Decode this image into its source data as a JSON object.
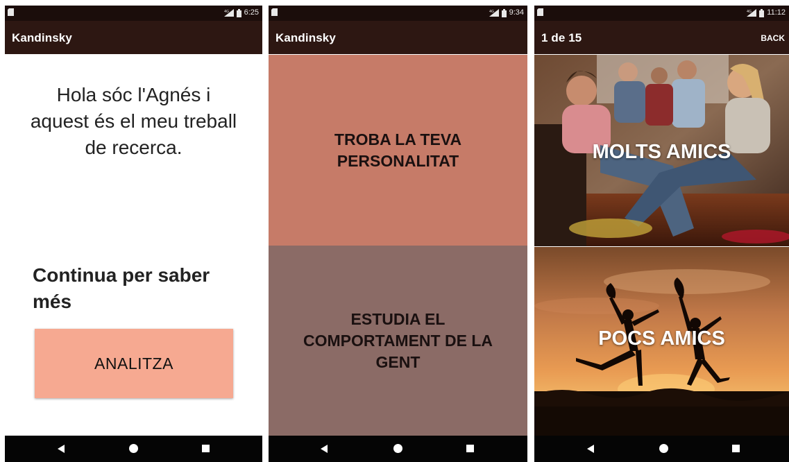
{
  "screens": [
    {
      "status_time": "6:25",
      "toolbar_title": "Kandinsky",
      "greeting": "Hola sóc l'Agnés i aquest és el meu treball de recerca.",
      "continue_text": "Continua per saber més",
      "analyze_button": "ANALITZA"
    },
    {
      "status_time": "9:34",
      "toolbar_title": "Kandinsky",
      "options": [
        {
          "label": "TROBA LA TEVA PERSONALITAT",
          "color": "#c67b68"
        },
        {
          "label": "ESTUDIA EL COMPORTAMENT DE LA GENT",
          "color": "#8b6b66"
        }
      ]
    },
    {
      "status_time": "11:12",
      "progress": "1 de 15",
      "back_label": "BACK",
      "choices": [
        {
          "label": "MOLTS AMICS",
          "image": "friends-party-photo"
        },
        {
          "label": "POCS AMICS",
          "image": "sunset-silhouettes-photo"
        }
      ]
    }
  ],
  "colors": {
    "status_bar": "#1b0d0b",
    "toolbar": "#2d1712",
    "accent_button": "#f6a991",
    "nav_bar": "#050505"
  },
  "icons": [
    "sd-card-icon",
    "signal-icon",
    "battery-icon",
    "nav-back-icon",
    "nav-home-icon",
    "nav-recents-icon"
  ]
}
